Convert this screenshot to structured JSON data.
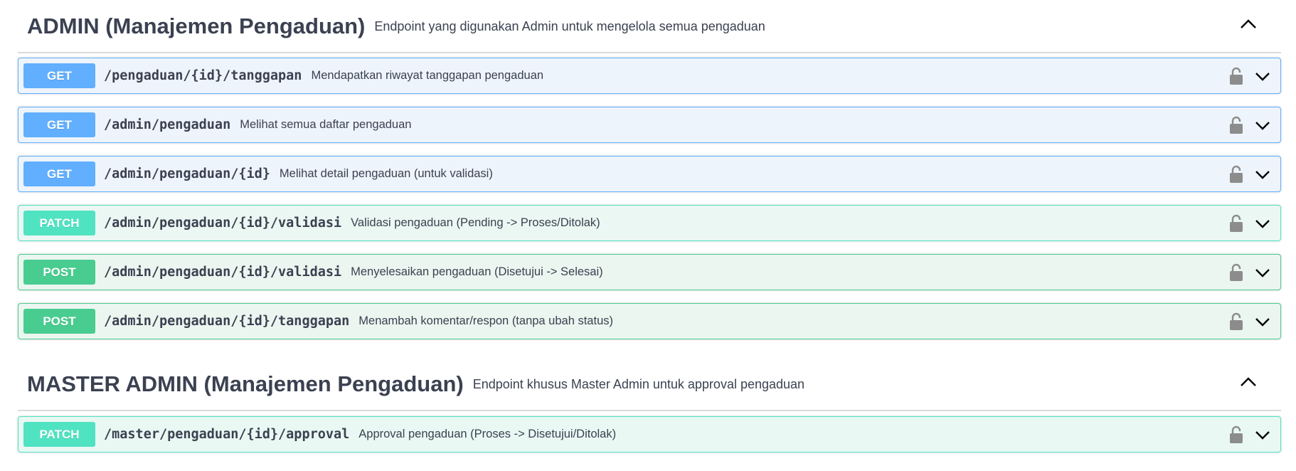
{
  "sections": [
    {
      "title": "ADMIN (Manajemen Pengaduan)",
      "description": "Endpoint yang digunakan Admin untuk mengelola semua pengaduan",
      "toggle_icon": "chevron-up-icon",
      "operations": [
        {
          "method": "GET",
          "path": "/pengaduan/{id}/tanggapan",
          "summary": "Mendapatkan riwayat tanggapan pengaduan"
        },
        {
          "method": "GET",
          "path": "/admin/pengaduan",
          "summary": "Melihat semua daftar pengaduan"
        },
        {
          "method": "GET",
          "path": "/admin/pengaduan/{id}",
          "summary": "Melihat detail pengaduan (untuk validasi)"
        },
        {
          "method": "PATCH",
          "path": "/admin/pengaduan/{id}/validasi",
          "summary": "Validasi pengaduan (Pending -> Proses/Ditolak)"
        },
        {
          "method": "POST",
          "path": "/admin/pengaduan/{id}/validasi",
          "summary": "Menyelesaikan pengaduan (Disetujui -> Selesai)"
        },
        {
          "method": "POST",
          "path": "/admin/pengaduan/{id}/tanggapan",
          "summary": "Menambah komentar/respon (tanpa ubah status)"
        }
      ]
    },
    {
      "title": "MASTER ADMIN (Manajemen Pengaduan)",
      "description": "Endpoint khusus Master Admin untuk approval pengaduan",
      "toggle_icon": "chevron-up-icon",
      "operations": [
        {
          "method": "PATCH",
          "path": "/master/pengaduan/{id}/approval",
          "summary": "Approval pengaduan (Proses -> Disetujui/Ditolak)"
        }
      ]
    }
  ],
  "icons": {
    "lock": "unlocked-padlock-icon",
    "expand": "chevron-down-icon"
  },
  "colors": {
    "get": "#61affe",
    "patch": "#50e3c2",
    "post": "#49cc90",
    "text": "#3b4151"
  }
}
